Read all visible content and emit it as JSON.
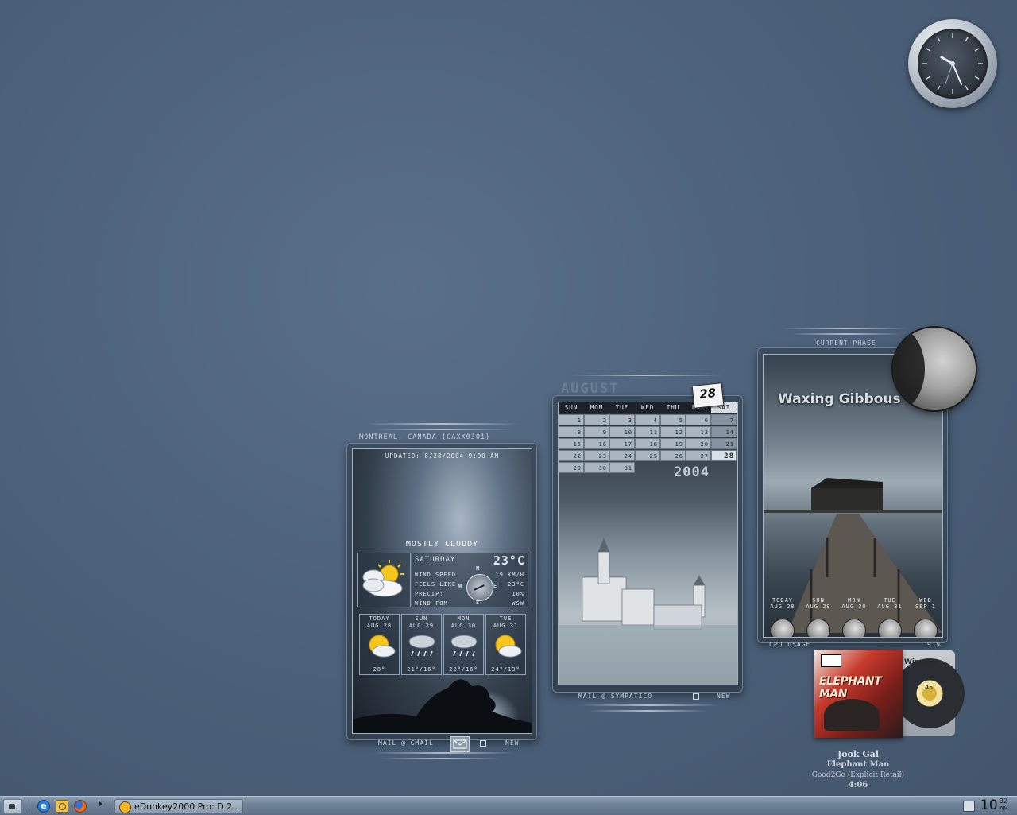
{
  "weather": {
    "location": "MONTREAL, CANADA (CAXX0301)",
    "updated": "UPDATED: 8/28/2004 9:00 AM",
    "condition": "MOSTLY CLOUDY",
    "day": "SATURDAY",
    "temp": "23°C",
    "labels": {
      "wind_speed": "WIND SPEED",
      "feels_like": "FEELS LIKE",
      "precip": "PRECIP:",
      "wind_from": "WIND FOM"
    },
    "values": {
      "wind_speed": "19 KM/H",
      "feels_like": "23°C",
      "precip": "10%",
      "wind_from": "WSW"
    },
    "compass": {
      "n": "N",
      "s": "S",
      "e": "E",
      "w": "W"
    },
    "forecast": [
      {
        "day": "TODAY",
        "date": "AUG 28",
        "temps": "28°",
        "icon": "sun-cloud-icon"
      },
      {
        "day": "SUN",
        "date": "AUG 29",
        "temps": "21°/16°",
        "icon": "rain-icon"
      },
      {
        "day": "MON",
        "date": "AUG 30",
        "temps": "22°/16°",
        "icon": "rain-icon"
      },
      {
        "day": "TUE",
        "date": "AUG 31",
        "temps": "24°/13°",
        "icon": "sun-cloud-icon"
      }
    ],
    "footer": {
      "mail": "MAIL @ GMAIL",
      "new": "NEW"
    }
  },
  "calendar": {
    "month": "AUGUST",
    "year": "2004",
    "today_badge": "28",
    "weekdays": [
      "SUN",
      "MON",
      "TUE",
      "WED",
      "THU",
      "FRI",
      "SAT"
    ],
    "days": [
      "1",
      "2",
      "3",
      "4",
      "5",
      "6",
      "7",
      "8",
      "9",
      "10",
      "11",
      "12",
      "13",
      "14",
      "15",
      "16",
      "17",
      "18",
      "19",
      "20",
      "21",
      "22",
      "23",
      "24",
      "25",
      "26",
      "27",
      "28",
      "29",
      "30",
      "31"
    ],
    "footer": {
      "mail": "MAIL @ SYMPATICO",
      "new": "NEW"
    }
  },
  "moon": {
    "header": "CURRENT PHASE",
    "phase": "Waxing Gibbous",
    "forecast": [
      {
        "day": "TODAY",
        "date": "AUG 28"
      },
      {
        "day": "SUN",
        "date": "AUG 29"
      },
      {
        "day": "MON",
        "date": "AUG 30"
      },
      {
        "day": "TUE",
        "date": "AUG 31"
      },
      {
        "day": "WED",
        "date": "SEP 1"
      }
    ],
    "cpu_label": "CPU USAGE",
    "cpu_value": "9 %"
  },
  "music": {
    "album_art_text": "ELEPHANT MAN",
    "player_label": "Winamp",
    "disc_label": "45",
    "track": "Jook Gal",
    "artist": "Elephant Man",
    "album": "Good2Go (Explicit Retail)",
    "duration": "4:06"
  },
  "taskbar": {
    "task_label": "eDonkey2000 Pro: D 2...",
    "clock_hour": "10",
    "clock_min": "32",
    "clock_ampm": "AM"
  }
}
